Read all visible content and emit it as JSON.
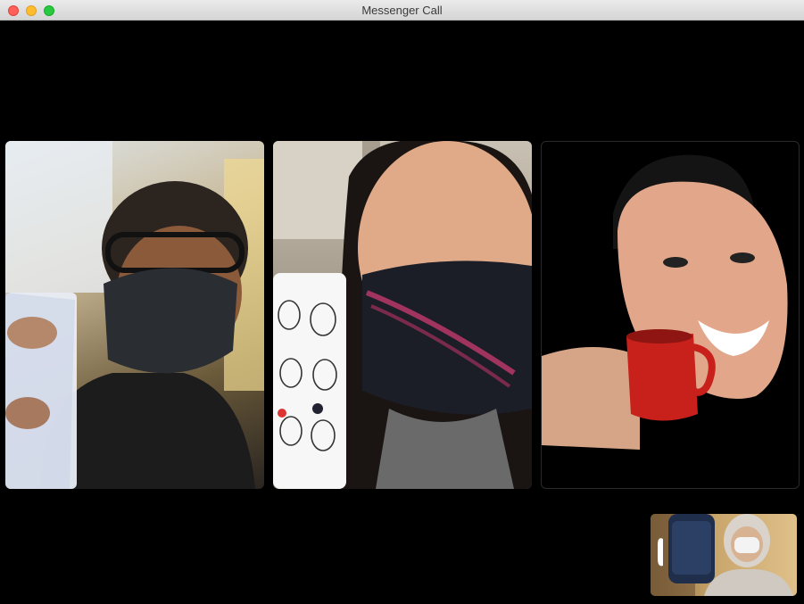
{
  "window": {
    "title": "Messenger Call"
  },
  "participants": [
    {
      "description_icon": "participant-video"
    },
    {
      "description_icon": "participant-video"
    },
    {
      "description_icon": "participant-video"
    }
  ],
  "self_view": {
    "icon": "self-video"
  },
  "colors": {
    "titlebar": "#e4e4e4",
    "background": "#000000",
    "close": "#fe5f57",
    "minimize": "#febc2e",
    "maximize": "#28c840"
  }
}
